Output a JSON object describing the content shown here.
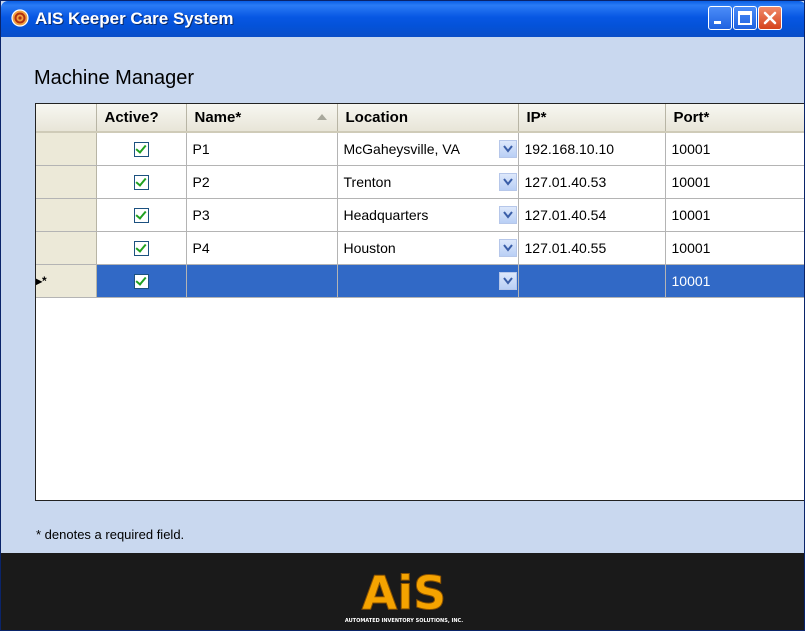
{
  "window": {
    "title": "AIS Keeper Care System"
  },
  "page": {
    "heading": "Machine Manager",
    "footnote": "* denotes a required field."
  },
  "grid": {
    "columns": [
      "Active?",
      "Name*",
      "Location",
      "IP*",
      "Port*"
    ],
    "rows": [
      {
        "active": true,
        "name": "P1",
        "location": "McGaheysville, VA",
        "ip": "192.168.10.10",
        "port": "10001"
      },
      {
        "active": true,
        "name": "P2",
        "location": "Trenton",
        "ip": "127.01.40.53",
        "port": "10001"
      },
      {
        "active": true,
        "name": "P3",
        "location": "Headquarters",
        "ip": "127.01.40.54",
        "port": "10001"
      },
      {
        "active": true,
        "name": "P4",
        "location": "Houston",
        "ip": "127.01.40.55",
        "port": "10001"
      }
    ],
    "new_row": {
      "marker": "▸*",
      "active": true,
      "name": "",
      "location": "",
      "ip": "",
      "port": "10001"
    }
  },
  "footer": {
    "logo_text": "AiS",
    "logo_tagline": "AUTOMATED INVENTORY SOLUTIONS, INC."
  },
  "colors": {
    "titlebar": "#0757e3",
    "window_bg": "#c9d8ef",
    "selection": "#3169c6",
    "footer": "#1a1a1a",
    "logo_orange": "#f5a300"
  }
}
